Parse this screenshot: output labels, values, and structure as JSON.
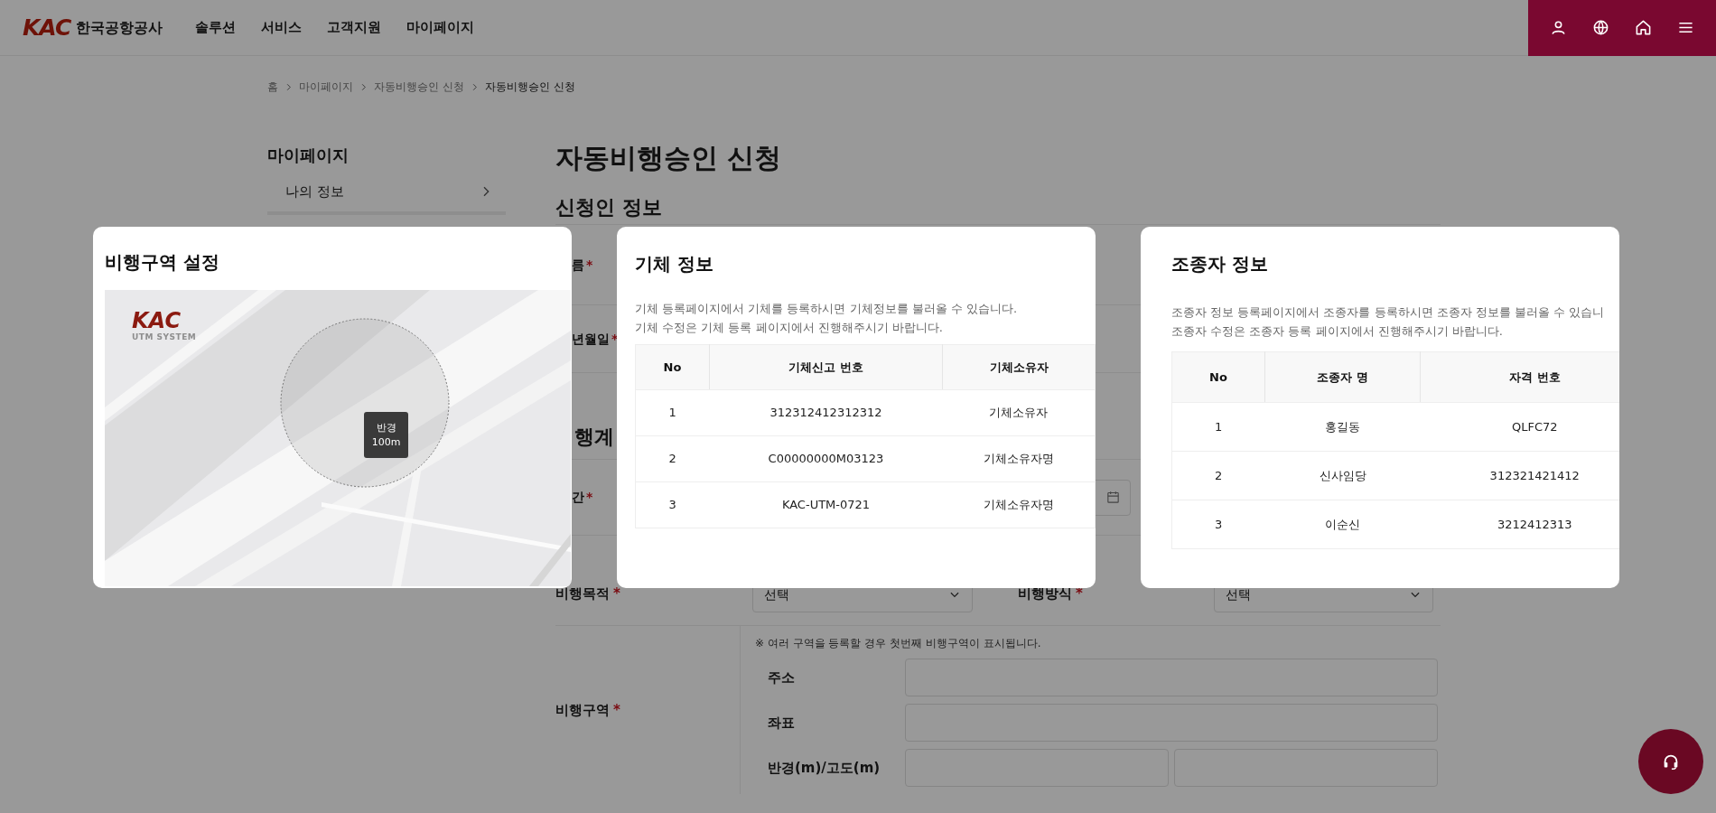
{
  "header": {
    "logo": "KAC",
    "org_name": "한국공항공사",
    "nav": [
      "솔루션",
      "서비스",
      "고객지원",
      "마이페이지"
    ],
    "utility_icons": [
      {
        "kind": "user"
      },
      {
        "kind": "globe"
      },
      {
        "kind": "home"
      },
      {
        "kind": "menu"
      }
    ]
  },
  "breadcrumb": [
    {
      "label": "홈",
      "current": false
    },
    {
      "label": "마이페이지",
      "current": false
    },
    {
      "label": "자동비행승인 신청",
      "current": false
    },
    {
      "label": "자동비행승인 신청",
      "current": true
    }
  ],
  "sidebar": {
    "title": "마이페이지",
    "items": [
      {
        "label": "나의 정보"
      }
    ]
  },
  "page": {
    "title": "자동비행승인 신청",
    "section": "신청인 정보",
    "applicant_fields": [
      {
        "label": "름",
        "required_mark": "*"
      },
      {
        "label": "년월일",
        "required_mark": "*"
      }
    ],
    "plan_heading": "행계",
    "period_field": {
      "label": "간",
      "required_mark": "*"
    },
    "purpose_row": [
      {
        "label": "비행목적",
        "required_mark": "*",
        "value": "선택"
      },
      {
        "label": "비행방식",
        "required_mark": "*",
        "value": "선택"
      }
    ],
    "area": {
      "label": "비행구역",
      "required_mark": "*",
      "note": "※ 여러 구역을 등록할 경우 첫번째 비행구역이 표시됩니다.",
      "fields": [
        {
          "label": "주소",
          "kind": "single"
        },
        {
          "label": "좌표",
          "kind": "single"
        },
        {
          "label": "반경(m)/고도(m)",
          "kind": "pair"
        }
      ]
    }
  },
  "modals": [
    {
      "kind": "map",
      "title": "비행구역 설정",
      "map": {
        "logo": "KAC",
        "logo_sub": "UTM SYSTEM",
        "radius_label": "반경",
        "radius_value": "100m"
      }
    },
    {
      "kind": "table",
      "title": "기체 정보",
      "description": [
        "기체 등록페이지에서 기체를 등록하시면 기체정보를 불러올 수 있습니다.",
        "기체 수정은 기체 등록 페이지에서 진행해주시기 바랍니다."
      ],
      "columns": [
        "No",
        "기체신고 번호",
        "기체소유자"
      ],
      "rows": [
        [
          "1",
          "312312412312312",
          "기체소유자"
        ],
        [
          "2",
          "C00000000M03123",
          "기체소유자명"
        ],
        [
          "3",
          "KAC-UTM-0721",
          "기체소유자명"
        ]
      ]
    },
    {
      "kind": "table",
      "title": "조종자 정보",
      "description": [
        "조종자 정보 등록페이지에서 조종자를 등록하시면 조종자 정보를 불러올 수 있습니",
        "조종자 수정은 조종자 등록 페이지에서 진행해주시기 바랍니다."
      ],
      "columns": [
        "No",
        "조종자 명",
        "자격 번호"
      ],
      "rows": [
        [
          "1",
          "홍길동",
          "QLFC72"
        ],
        [
          "2",
          "신사임당",
          "312321421412"
        ],
        [
          "3",
          "이순신",
          "3212412313"
        ]
      ]
    }
  ]
}
